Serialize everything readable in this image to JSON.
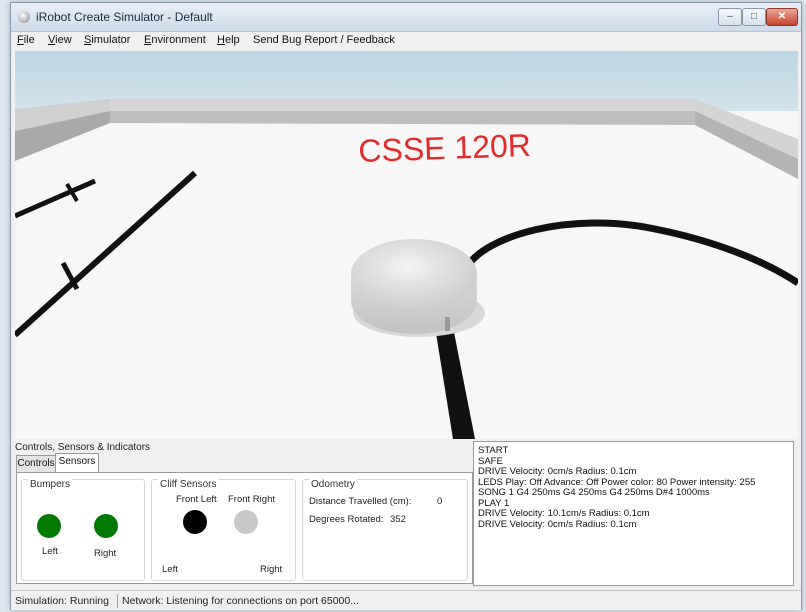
{
  "window": {
    "title": "iRobot Create Simulator - Default",
    "controls": {
      "minimize": "–",
      "maximize": "□",
      "close": "✕"
    }
  },
  "menu": [
    {
      "label": "File",
      "accel": "F",
      "rest": "ile"
    },
    {
      "label": "View",
      "accel": "V",
      "rest": "iew"
    },
    {
      "label": "Simulator",
      "accel": "S",
      "rest": "imulator"
    },
    {
      "label": "Environment",
      "accel": "E",
      "rest": "nvironment"
    },
    {
      "label": "Help",
      "accel": "H",
      "rest": "elp"
    },
    {
      "label": "Send Bug Report / Feedback",
      "accel": "",
      "rest": "Send Bug Report / Feedback"
    }
  ],
  "scene": {
    "floor_text": "CSSE 120R",
    "floor_text_color": "#e32a2a"
  },
  "panel": {
    "title": "Controls, Sensors & Indicators",
    "tabs": [
      "Controls",
      "Sensors"
    ],
    "active_tab": "Sensors",
    "bumpers": {
      "title": "Bumpers",
      "left_label": "Left",
      "right_label": "Right",
      "left_color": "#008000",
      "right_color": "#008000"
    },
    "cliff": {
      "title": "Cliff Sensors",
      "front_left_label": "Front Left",
      "front_right_label": "Front Right",
      "left_label": "Left",
      "right_label": "Right",
      "front_left_color": "#000000",
      "front_right_color": "#c8c8c8"
    },
    "odometry": {
      "title": "Odometry",
      "distance_label": "Distance Travelled (cm):",
      "distance_value": "0",
      "degrees_label": "Degrees Rotated:",
      "degrees_value": "352"
    }
  },
  "log": [
    "START",
    "SAFE",
    "DRIVE Velocity: 0cm/s Radius: 0.1cm",
    "LEDS Play: Off Advance: Off Power color: 80 Power intensity: 255",
    "SONG 1 G4 250ms G4 250ms G4 250ms D#4 1000ms",
    "PLAY 1",
    "DRIVE Velocity: 10.1cm/s Radius: 0.1cm",
    "DRIVE Velocity: 0cm/s Radius: 0.1cm"
  ],
  "status": {
    "simulation": "Simulation: Running",
    "network": "Network: Listening for connections on port 65000..."
  }
}
